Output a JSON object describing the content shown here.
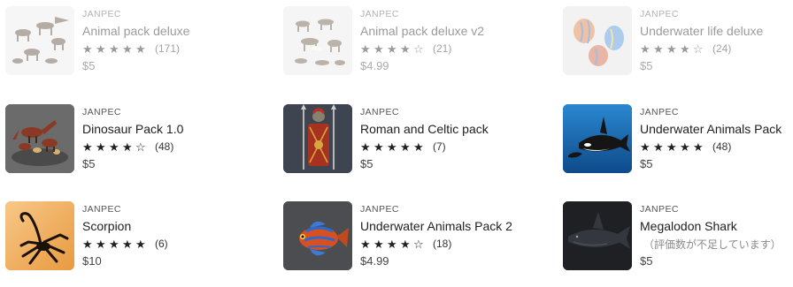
{
  "cards": [
    {
      "publisher": "JANPEC",
      "title": "Animal pack deluxe",
      "stars": "★★★★★",
      "count": "(171)",
      "price": "$5",
      "thumb": "animals-icon",
      "dim": true
    },
    {
      "publisher": "JANPEC",
      "title": "Animal pack deluxe v2",
      "stars": "★★★★☆",
      "count": "(21)",
      "price": "$4.99",
      "thumb": "animals-v2-icon",
      "dim": true
    },
    {
      "publisher": "JANPEC",
      "title": "Underwater life deluxe",
      "stars": "★★★★☆",
      "count": "(24)",
      "price": "$5",
      "thumb": "tropical-fish-icon",
      "dim": true
    },
    {
      "publisher": "JANPEC",
      "title": "Dinosaur Pack 1.0",
      "stars": "★★★★☆",
      "count": "(48)",
      "price": "$5",
      "thumb": "dinosaur-icon",
      "dim": false
    },
    {
      "publisher": "JANPEC",
      "title": "Roman and Celtic pack",
      "stars": "★★★★★",
      "count": "(7)",
      "price": "$5",
      "thumb": "roman-shield-icon",
      "dim": false
    },
    {
      "publisher": "JANPEC",
      "title": "Underwater Animals Pack",
      "stars": "★★★★★",
      "count": "(48)",
      "price": "$5",
      "thumb": "orca-icon",
      "dim": false
    },
    {
      "publisher": "JANPEC",
      "title": "Scorpion",
      "stars": "★★★★★",
      "count": "(6)",
      "price": "$10",
      "thumb": "scorpion-icon",
      "dim": false
    },
    {
      "publisher": "JANPEC",
      "title": "Underwater Animals Pack 2",
      "stars": "★★★★☆",
      "count": "(18)",
      "price": "$4.99",
      "thumb": "mandarin-fish-icon",
      "dim": false
    },
    {
      "publisher": "JANPEC",
      "title": "Megalodon Shark",
      "stars": "",
      "count": "",
      "no_reviews": "（評価数が不足しています）",
      "price": "$5",
      "thumb": "shark-icon",
      "dim": false
    }
  ]
}
